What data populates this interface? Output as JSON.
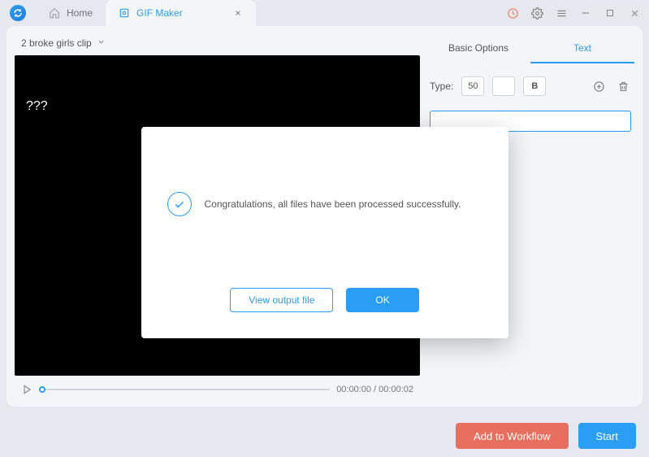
{
  "titlebar": {
    "tabs": [
      {
        "label": "Home"
      },
      {
        "label": "GIF Maker"
      }
    ]
  },
  "clip": {
    "name": "2 broke girls clip"
  },
  "video": {
    "overlay_text": "???"
  },
  "player": {
    "time": "00:00:00 / 00:00:02"
  },
  "side": {
    "tab_basic": "Basic Options",
    "tab_text": "Text",
    "type_label": "Type:",
    "size_value": "50",
    "bold_label": "B"
  },
  "bottom": {
    "workflow": "Add to Workflow",
    "start": "Start"
  },
  "modal": {
    "message": "Congratulations, all files have been processed successfully.",
    "view_output": "View output file",
    "ok": "OK"
  }
}
